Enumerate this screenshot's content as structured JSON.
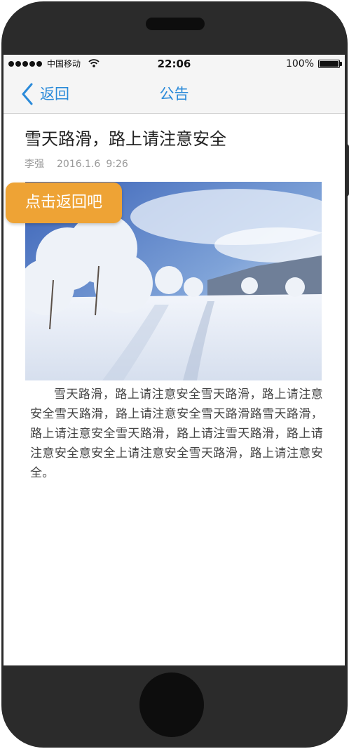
{
  "status_bar": {
    "carrier": "中国移动",
    "time": "22:06",
    "battery_percent": "100%",
    "signal_bars": 5,
    "battery_level": 1.0
  },
  "nav_bar": {
    "back_label": "返回",
    "title": "公告",
    "accent_color": "#2a8ad9"
  },
  "article": {
    "title": "雪天路滑，路上请注意安全",
    "author": "李强",
    "date": "2016.1.6",
    "time": "9:26",
    "image_icon": "snowy-landscape-photo",
    "body": "雪天路滑，路上请注意安全雪天路滑，路上请注意安全雪天路滑，路上请注意安全雪天路滑路雪天路滑，路上请注意安全雪天路滑，路上请注雪天路滑，路上请注意安全意安全上请注意安全雪天路滑，路上请注意安全。"
  },
  "back_hint": {
    "label": "点击返回吧",
    "color": "#eea335"
  }
}
